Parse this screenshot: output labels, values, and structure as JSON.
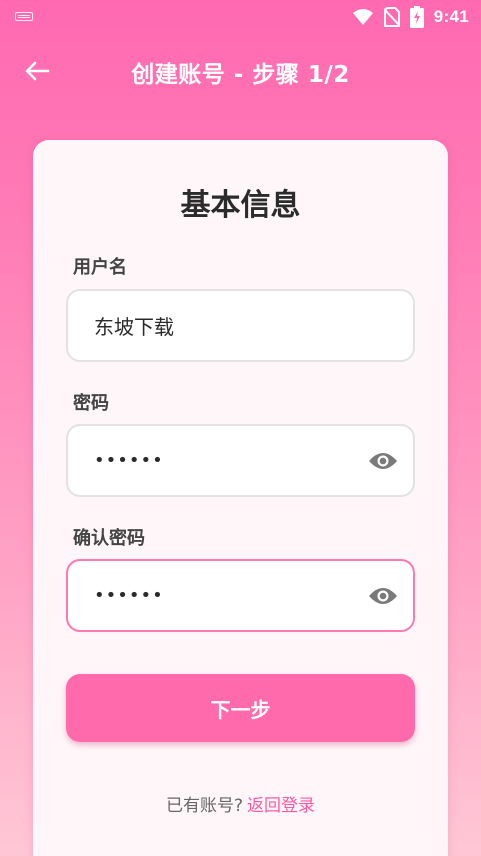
{
  "status_bar": {
    "time": "9:41",
    "icons": [
      "keyboard-icon",
      "wifi-icon",
      "no-sim-icon",
      "battery-charging-icon"
    ]
  },
  "app_bar": {
    "back_icon": "arrow-left-icon",
    "title": "创建账号 - 步骤 1/2"
  },
  "form": {
    "section_title": "基本信息",
    "username": {
      "label": "用户名",
      "value": "东坡下载"
    },
    "password": {
      "label": "密码",
      "value": "••••••",
      "toggle_icon": "eye-icon"
    },
    "confirm_password": {
      "label": "确认密码",
      "value": "••••••",
      "toggle_icon": "eye-icon",
      "focused": true
    },
    "next_label": "下一步"
  },
  "footer": {
    "prompt": "已有账号?",
    "link": "返回登录"
  },
  "colors": {
    "accent": "#ff6aad",
    "link": "#ff5aa3",
    "focus_border": "#ff78b4",
    "card_bg": "#fff6f9"
  }
}
